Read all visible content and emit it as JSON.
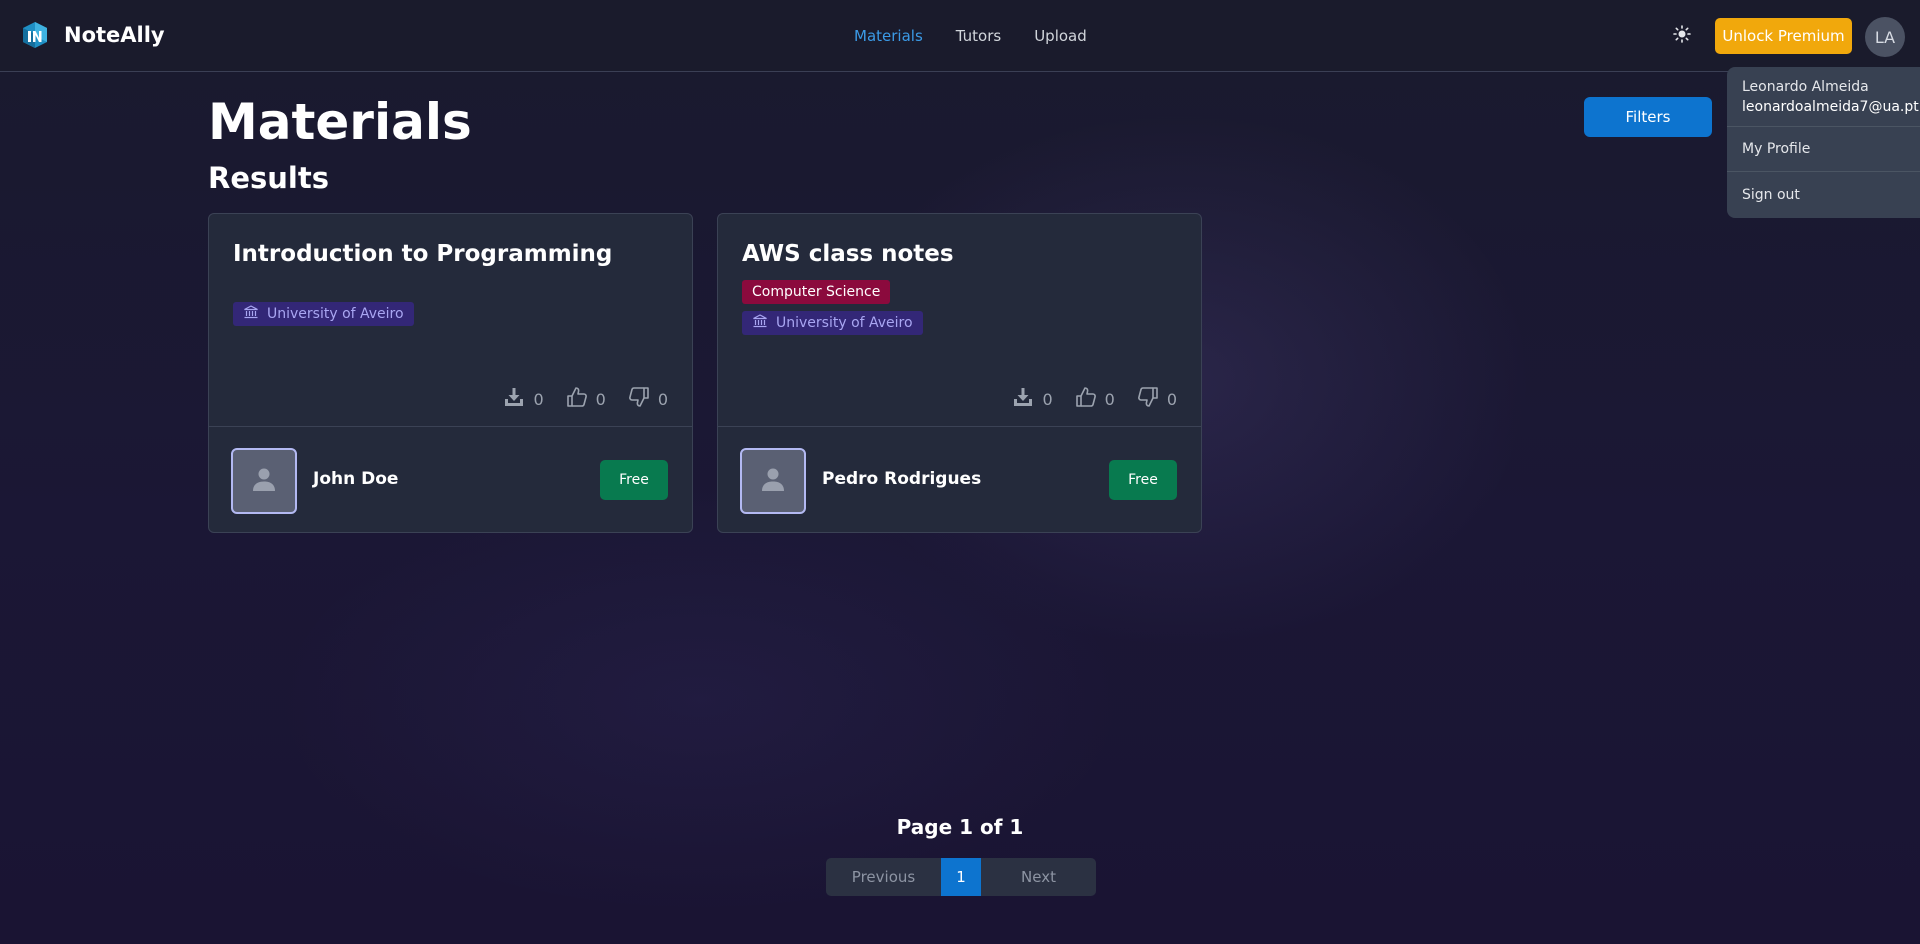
{
  "header": {
    "brand": "NoteAlly",
    "nav": [
      "Materials",
      "Tutors",
      "Upload"
    ],
    "active_nav": "Materials",
    "premium_label": "Unlock Premium",
    "avatar_initials": "LA"
  },
  "user_menu": {
    "name": "Leonardo Almeida",
    "email": "leonardoalmeida7@ua.pt",
    "items": [
      "My Profile",
      "Sign out"
    ]
  },
  "main": {
    "title": "Materials",
    "subtitle": "Results",
    "filters_label": "Filters"
  },
  "cards": [
    {
      "title": "Introduction to Programming",
      "subject": "",
      "university": "University of Aveiro",
      "downloads": "0",
      "likes": "0",
      "dislikes": "0",
      "author": "John Doe",
      "price": "Free"
    },
    {
      "title": "AWS class notes",
      "subject": "Computer Science",
      "university": "University of Aveiro",
      "downloads": "0",
      "likes": "0",
      "dislikes": "0",
      "author": "Pedro Rodrigues",
      "price": "Free"
    }
  ],
  "pagination": {
    "info": "Page 1 of 1",
    "previous": "Previous",
    "current": "1",
    "next": "Next"
  },
  "colors": {
    "accent": "#0d74cf",
    "premium": "#f1a80c",
    "free": "#087a4f",
    "subject_tag": "#8b0a3d",
    "university_tag": "#332777"
  },
  "icons": [
    "logo-icon",
    "sun-icon",
    "university-icon",
    "download-icon",
    "thumbs-up-icon",
    "thumbs-down-icon",
    "user-placeholder-icon"
  ]
}
